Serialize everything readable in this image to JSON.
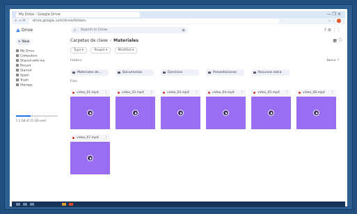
{
  "browser": {
    "tab_title": "My Drive - Google Drive",
    "url": "drive.google.com/drive/folders",
    "win_controls": "— ❐ ✕"
  },
  "app": {
    "logo": "Drive",
    "search_placeholder": "Search in Drive",
    "top_right_icons": "? ⚙ ⋮⋮"
  },
  "sidebar": {
    "new_label": "+ New",
    "items": [
      {
        "label": "My Drive"
      },
      {
        "label": "Computers"
      },
      {
        "label": "Shared with me"
      },
      {
        "label": "Recent"
      },
      {
        "label": "Starred"
      },
      {
        "label": "Spam"
      },
      {
        "label": "Trash"
      },
      {
        "label": "Storage"
      }
    ],
    "storage_fraction": 0.35,
    "storage_text": "5.2 GB of 15 GB used"
  },
  "main": {
    "crumbs": [
      "Carpetas de clase",
      "Materiales"
    ],
    "right_icons": "▦ ⓘ",
    "filters": [
      "Type ▾",
      "People ▾",
      "Modified ▾"
    ],
    "folders_label": "Folders",
    "sort_label": "Name ↑",
    "folders": [
      {
        "name": "Materiales de..."
      },
      {
        "name": "Documentos"
      },
      {
        "name": "Ejercicios"
      },
      {
        "name": "Presentaciones"
      },
      {
        "name": "Recursos extra"
      }
    ],
    "files_label": "Files",
    "files": [
      {
        "name": "video_01.mp4"
      },
      {
        "name": "video_02.mp4"
      },
      {
        "name": "video_03.mp4"
      },
      {
        "name": "video_04.mp4"
      },
      {
        "name": "video_05.mp4"
      },
      {
        "name": "video_06.mp4"
      },
      {
        "name": "video_07.mp4"
      }
    ]
  },
  "colors": {
    "thumbnail": "#9a6ef2",
    "accent": "#1a73e8",
    "outer": "#1f4f7d"
  }
}
